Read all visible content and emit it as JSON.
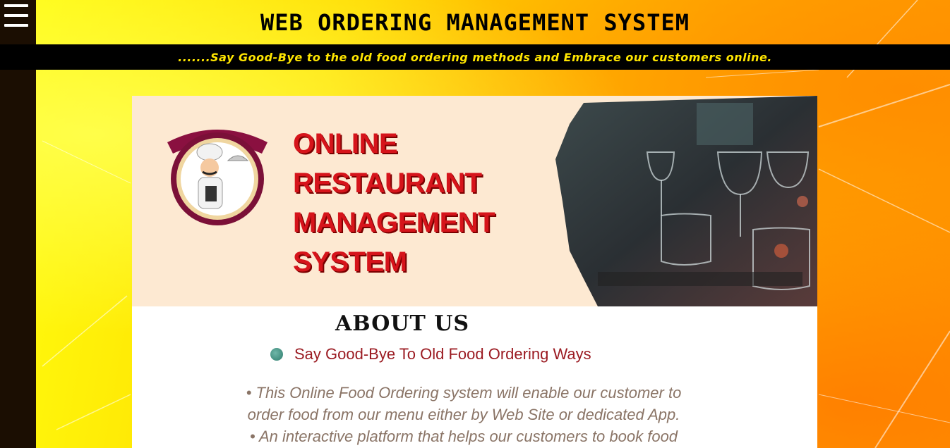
{
  "header": {
    "title": "WEB ORDERING MANAGEMENT SYSTEM",
    "tagline": ".......Say Good-Bye to the old food ordering methods and Embrace our customers online."
  },
  "nav": {
    "menu_icon": "hamburger-menu-icon"
  },
  "banner": {
    "lines": [
      "ONLINE",
      "RESTAURANT",
      "MANAGEMENT",
      "SYSTEM"
    ],
    "logo": "chef-logo",
    "photo": "wine-glasses-photo"
  },
  "about": {
    "title": "ABOUT US",
    "subtitle": "Say Good-Bye To Old Food Ordering Ways",
    "bullets": [
      "• This Online Food Ordering system will enable our customer to",
      "order food from our menu either by Web Site or dedicated App.",
      "• An interactive platform that helps our customers to book food"
    ]
  },
  "colors": {
    "accent_red": "#d6141b",
    "tagline_yellow": "#ffe600",
    "subtitle_red": "#9b1b22"
  }
}
